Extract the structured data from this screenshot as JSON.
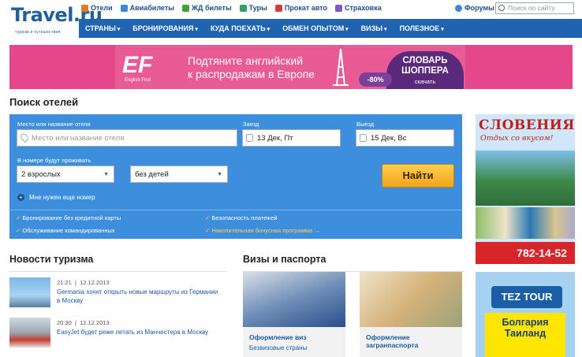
{
  "logo": {
    "text": "Travel.ru",
    "tagline": "туризм и путешествия"
  },
  "top_links": [
    {
      "label": "Отели",
      "icon": "hotel-icon",
      "color": "#e07a20"
    },
    {
      "label": "Авиабилеты",
      "icon": "plane-icon",
      "color": "#3a8ad8"
    },
    {
      "label": "ЖД билеты",
      "icon": "train-icon",
      "color": "#3fa33c"
    },
    {
      "label": "Туры",
      "icon": "palm-icon",
      "color": "#2ea060"
    },
    {
      "label": "Прокат авто",
      "icon": "car-icon",
      "color": "#d63a3a"
    },
    {
      "label": "Страховка",
      "icon": "umbrella-icon",
      "color": "#7a5ac8"
    }
  ],
  "forum_label": "Форумы",
  "search": {
    "placeholder": "Поиск по сайту"
  },
  "nav": [
    "СТРАНЫ",
    "БРОНИРОВАНИЯ",
    "КУДА ПОЕХАТЬ",
    "ОБМЕН ОПЫТОМ",
    "ВИЗЫ",
    "ПОЛЕЗНОЕ"
  ],
  "banner": {
    "brand": "EF",
    "brand_caption": "English First",
    "line1": "Подтяните английский",
    "line2": "к распродажам в Европе",
    "dict_line1": "СЛОВАРЬ",
    "dict_line2": "ШОППЕРА",
    "dict_action": "скачать",
    "discount": "-80%"
  },
  "hotel_search": {
    "title": "Поиск отелей",
    "place_label": "Место или название отеля",
    "place_placeholder": "Место или название отеля",
    "checkin_label": "Заезд",
    "checkin_value": "13 Дек, Пт",
    "checkout_label": "Выезд",
    "checkout_value": "15 Дек, Вс",
    "room_label": "В номере будут проживать",
    "adults_value": "2 взрослых",
    "children_value": "без детей",
    "find_button": "Найти",
    "add_room": "Мне нужен еще номер",
    "features": [
      "Бронирование без кредитной карты",
      "Безопасность платежей",
      "Обслуживание командированных",
      "Накопительная бонусная программа →"
    ]
  },
  "news": {
    "title": "Новости туризма",
    "items": [
      {
        "time": "21:21",
        "date": "12.12.2013",
        "text": "Germania хочет открыть новые маршруты из Германии в Москву"
      },
      {
        "time": "20:30",
        "date": "12.12.2013",
        "text": "EasyJet будет реже летать из Манчестера в Москву"
      }
    ]
  },
  "visas": {
    "title": "Визы и паспорта",
    "cards": [
      {
        "title": "Оформление виз",
        "sub": "Безвизовые страны"
      },
      {
        "title": "Оформление загранпаспорта",
        "sub": ""
      }
    ]
  },
  "ads": {
    "slovenia_title": "СЛОВЕНИЯ",
    "slovenia_sub": "Отдых со вкусом!",
    "slovenia_phone": "782-14-52",
    "tez_brand": "TEZ TOUR",
    "tez_line1": "Болгария",
    "tez_line2": "Таиланд"
  },
  "colors": {
    "nav_bg": "#1f64b0",
    "panel_bg": "#3d8fde",
    "banner_bg": "#e4478a",
    "find_btn": "#f3a41d"
  }
}
